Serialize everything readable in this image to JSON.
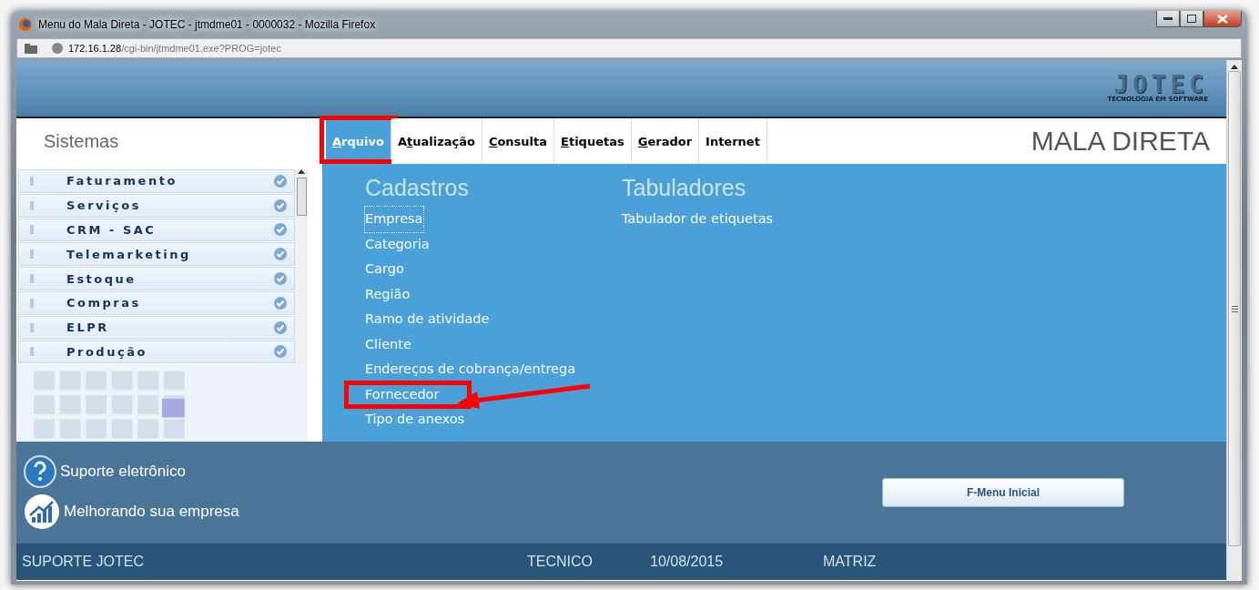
{
  "window": {
    "title": "Menu do Mala Direta - JOTEC - jtmdme01 - 0000032 - Mozilla Firefox"
  },
  "address_bar": {
    "host": "172.16.1.28",
    "path": "/cgi-bin/jtmdme01.exe?PROG=jotec"
  },
  "logo": {
    "name": "JOTEC",
    "tagline": "TECNOLOGIA EM SOFTWARE"
  },
  "sidebar": {
    "title": "Sistemas",
    "items": [
      {
        "label": "Faturamento"
      },
      {
        "label": "Serviços"
      },
      {
        "label": "CRM - SAC"
      },
      {
        "label": "Telemarketing"
      },
      {
        "label": "Estoque"
      },
      {
        "label": "Compras"
      },
      {
        "label": "ELPR"
      },
      {
        "label": "Produção"
      }
    ]
  },
  "menu": [
    {
      "key": "A",
      "post": "rquivo",
      "selected": true,
      "highlighted": true
    },
    {
      "pre": "A",
      "key": "t",
      "post": "ualização",
      "selected": false,
      "highlighted": false
    },
    {
      "key": "C",
      "post": "onsulta",
      "selected": false,
      "highlighted": false
    },
    {
      "key": "E",
      "post": "tiquetas",
      "selected": false,
      "highlighted": false
    },
    {
      "key": "G",
      "post": "erador",
      "selected": false,
      "highlighted": false
    },
    {
      "post": "Internet",
      "selected": false,
      "highlighted": false
    }
  ],
  "module_title": "MALA DIRETA",
  "dropdown": {
    "columns": [
      {
        "heading": "Cadastros",
        "items": [
          {
            "label": "Empresa",
            "focused": true,
            "highlighted": false
          },
          {
            "label": "Categoria",
            "focused": false,
            "highlighted": false
          },
          {
            "label": "Cargo",
            "focused": false,
            "highlighted": false
          },
          {
            "label": "Região",
            "focused": false,
            "highlighted": false
          },
          {
            "label": "Ramo de atividade",
            "focused": false,
            "highlighted": false
          },
          {
            "label": "Cliente",
            "focused": false,
            "highlighted": false
          },
          {
            "label": "Endereços de cobrança/entrega",
            "focused": false,
            "highlighted": false
          },
          {
            "label": "Fornecedor",
            "focused": false,
            "highlighted": true
          },
          {
            "label": "Tipo de anexos",
            "focused": false,
            "highlighted": false
          }
        ]
      },
      {
        "heading": "Tabuladores",
        "items": [
          {
            "label": "Tabulador de etiquetas",
            "focused": false,
            "highlighted": false
          }
        ]
      }
    ]
  },
  "footer": {
    "links": [
      {
        "kind": "help",
        "label": "Suporte eletrônico"
      },
      {
        "kind": "chart",
        "label": "Melhorando sua empresa"
      }
    ],
    "button": "F-Menu Inicial"
  },
  "status_bar": [
    "SUPORTE JOTEC",
    "TECNICO",
    "10/08/2015",
    "MATRIZ"
  ]
}
